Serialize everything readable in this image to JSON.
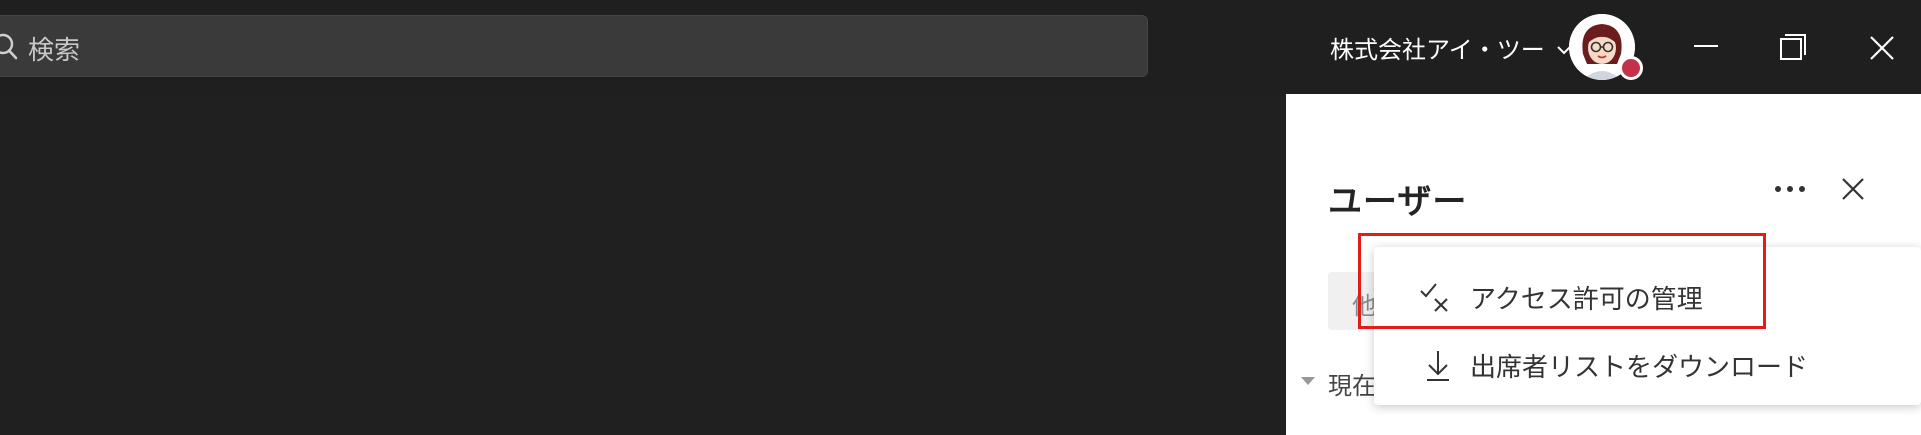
{
  "search": {
    "placeholder": "検索"
  },
  "header": {
    "org_name": "株式会社アイ・ツー"
  },
  "panel": {
    "title": "ユーザー",
    "invite_partial": "他",
    "section_label": "現在"
  },
  "menu": {
    "items": [
      {
        "label": "アクセス許可の管理",
        "icon": "check-x-icon"
      },
      {
        "label": "出席者リストをダウンロード",
        "icon": "download-icon"
      }
    ]
  },
  "colors": {
    "highlight": "#e41b1b",
    "presence": "#c4314b",
    "panel_bg": "#ffffff",
    "app_bg": "#202020"
  }
}
